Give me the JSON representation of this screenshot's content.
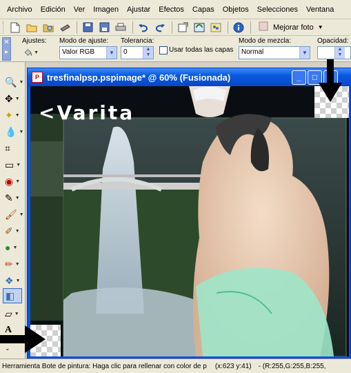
{
  "menu": [
    "Archivo",
    "Edición",
    "Ver",
    "Imagen",
    "Ajustar",
    "Efectos",
    "Capas",
    "Objetos",
    "Selecciones",
    "Ventana"
  ],
  "toolbar": {
    "buttons": [
      "new-file-icon",
      "open-folder-icon",
      "browse-icon",
      "scanner-icon",
      "save-icon",
      "save-as-icon",
      "print-icon",
      "undo-icon",
      "redo-icon",
      "fit-window-icon",
      "refresh-icon",
      "palette-icon",
      "info-icon"
    ],
    "photo_label": "Mejorar foto"
  },
  "options": {
    "adjust_label": "Ajustes:",
    "mode_label": "Modo de ajuste:",
    "mode_value": "Valor RGB",
    "tolerance_label": "Tolerancia:",
    "tolerance_value": "0",
    "use_all_layers_label": "Usar todas las capas",
    "blend_label": "Modo de mezcla:",
    "blend_value": "Normal",
    "opacity_label": "Opacidad:"
  },
  "document": {
    "title": "tresfinalpsp.pspimage* @  60% (Fusionada)",
    "overlay_text": "<Varita"
  },
  "status": {
    "hint": "Herramienta Bote de pintura: Haga clic para rellenar con color de p",
    "coords": "(x:623 y:41)",
    "rgb": "- (R:255,G:255,B:255,"
  },
  "colors": {
    "title_blue": "#0a5ae0",
    "chrome": "#ece9d8"
  }
}
